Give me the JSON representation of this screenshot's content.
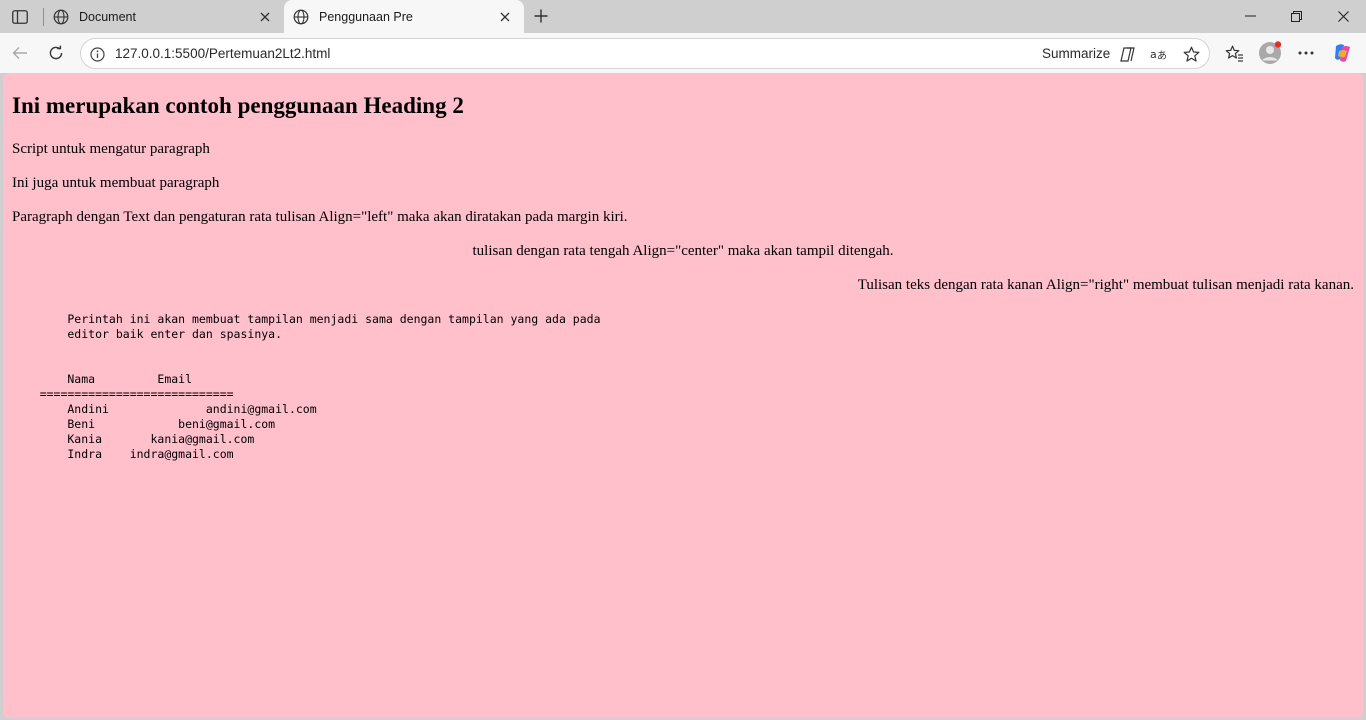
{
  "browser": {
    "tabs": [
      {
        "title": "Document",
        "active": false
      },
      {
        "title": "Penggunaan Pre",
        "active": true
      }
    ],
    "address": {
      "url": "127.0.0.1:5500/Pertemuan2Lt2.html",
      "summarize_label": "Summarize"
    },
    "icons": {
      "sidebar": "sidebar-toggle-icon",
      "tab": "globe-icon",
      "back": "back-arrow-icon",
      "refresh": "refresh-icon",
      "info": "info-icon",
      "favorites": "star-icon",
      "collections": "favorites-list-icon",
      "profile": "avatar",
      "more": "ellipsis-icon",
      "copilot": "copilot-icon"
    },
    "colors": {
      "tab_strip": "#cfcfcf",
      "toolbar": "#f7f7f7",
      "page_background": "#ffc0cb"
    }
  },
  "page": {
    "heading": "Ini merupakan contoh penggunaan Heading 2",
    "paragraphs": [
      "Script untuk mengatur paragraph",
      "Ini juga untuk membuat paragraph",
      "Paragraph dengan Text dan pengaturan rata tulisan Align=\"left\" maka akan diratakan pada margin kiri.",
      "tulisan dengan rata tengah Align=\"center\" maka akan tampil ditengah.",
      "Tulisan teks dengan rata kanan Align=\"right\" membuat tulisan menjadi rata kanan."
    ],
    "pre_text": "        Perintah ini akan membuat tampilan menjadi sama dengan tampilan yang ada pada\n        editor baik enter dan spasinya.",
    "pre_table": "        Nama         Email\n    ============================\n        Andini              andini@gmail.com\n        Beni            beni@gmail.com\n        Kania       kania@gmail.com\n        Indra    indra@gmail.com"
  }
}
